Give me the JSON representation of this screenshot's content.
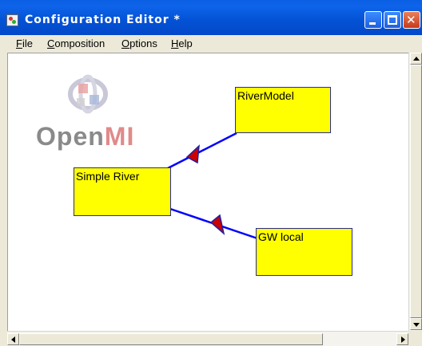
{
  "window": {
    "title": "Configuration Editor *"
  },
  "menu": [
    {
      "label": "File",
      "u": "F",
      "rest": "ile"
    },
    {
      "label": "Composition",
      "u": "C",
      "rest": "omposition"
    },
    {
      "label": "Options",
      "u": "O",
      "rest": "ptions"
    },
    {
      "label": "Help",
      "u": "H",
      "rest": "elp"
    }
  ],
  "logo": {
    "text_a": "Open",
    "text_b": "MI"
  },
  "models": [
    {
      "id": "rivermodel",
      "label": "RiverModel"
    },
    {
      "id": "simple-river",
      "label": "Simple River"
    },
    {
      "id": "gw-local",
      "label": "GW local"
    }
  ],
  "links": [
    {
      "from": "rivermodel",
      "to": "simple-river"
    },
    {
      "from": "gw-local",
      "to": "simple-river"
    }
  ],
  "colors": {
    "model_fill": "#ffff00",
    "link": "#0000ff",
    "arrow": "#cc0000",
    "titlebar": "#0453d6"
  }
}
